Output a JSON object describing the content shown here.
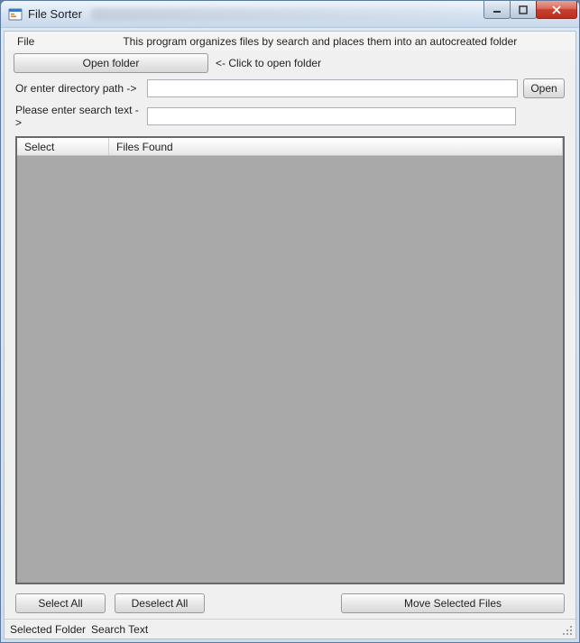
{
  "window": {
    "title": "File Sorter"
  },
  "menubar": {
    "file": "File"
  },
  "description": "This program organizes files by search and places them into an autocreated folder",
  "toolbar": {
    "open_folder_label": "Open folder",
    "open_folder_hint": "<- Click to open folder"
  },
  "form": {
    "directory_label": "Or enter directory path ->",
    "directory_value": "",
    "open_label": "Open",
    "search_label": "Please enter search text ->",
    "search_value": ""
  },
  "listview": {
    "columns": {
      "select": "Select",
      "files_found": "Files Found"
    }
  },
  "buttons": {
    "select_all": "Select All",
    "deselect_all": "Deselect All",
    "move_selected": "Move Selected Files"
  },
  "statusbar": {
    "selected_folder": "Selected Folder",
    "search_text": "Search Text"
  }
}
